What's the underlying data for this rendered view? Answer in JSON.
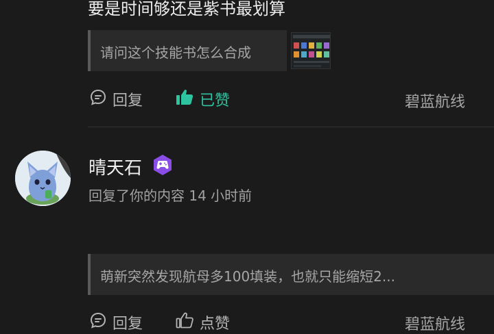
{
  "comment_top": {
    "text": "要是时间够还是紫书最划算",
    "quote": "请问这个技能书怎么合成",
    "actions": {
      "reply_label": "回复",
      "liked_label": "已赞",
      "source": "碧蓝航线"
    }
  },
  "comment_second": {
    "username": "晴天石",
    "meta": "回复了你的内容 14 小时前",
    "quote": "萌新突然发现航母多100填装，也就只能缩短2...",
    "actions": {
      "reply_label": "回复",
      "like_label": "点赞",
      "source": "碧蓝航线"
    }
  },
  "colors": {
    "liked_accent": "#2ec4a0",
    "badge_purple": "#8a4de6",
    "background": "#1b1b1b"
  },
  "icons": {
    "reply": "chat-bubble-icon",
    "like": "thumbs-up-icon",
    "badge": "gamepad-badge-icon"
  }
}
